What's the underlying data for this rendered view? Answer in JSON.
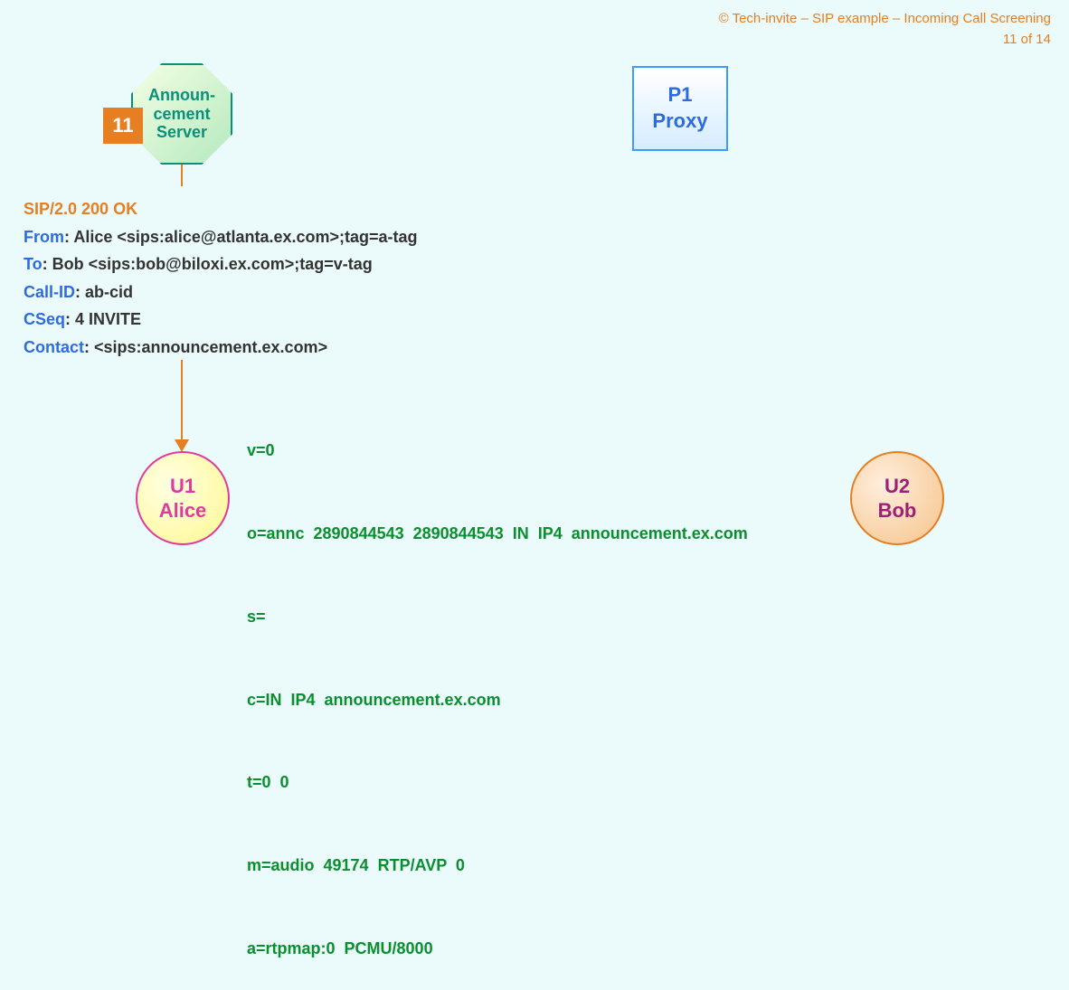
{
  "header": {
    "title": "© Tech-invite – SIP example – Incoming Call Screening",
    "page": "11 of 14"
  },
  "step": "11",
  "announcement": {
    "line1": "Announ-",
    "line2": "cement",
    "line3": "Server"
  },
  "proxy": {
    "line1": "P1",
    "line2": "Proxy"
  },
  "alice": {
    "line1": "U1",
    "line2": "Alice"
  },
  "bob": {
    "line1": "U2",
    "line2": "Bob"
  },
  "sip": {
    "status": "SIP/2.0 200 OK",
    "headers": [
      {
        "name": "From",
        "value": ": Alice <sips:alice@atlanta.ex.com>;tag=a-tag"
      },
      {
        "name": "To",
        "value": ": Bob <sips:bob@biloxi.ex.com>;tag=v-tag"
      },
      {
        "name": "Call-ID",
        "value": ": ab-cid"
      },
      {
        "name": "CSeq",
        "value": ": 4 INVITE"
      },
      {
        "name": "Contact",
        "value": ": <sips:announcement.ex.com>"
      }
    ]
  },
  "sdp": [
    "v=0",
    "o=annc  2890844543  2890844543  IN  IP4  announcement.ex.com",
    "s=",
    "c=IN  IP4  announcement.ex.com",
    "t=0  0",
    "m=audio  49174  RTP/AVP  0",
    "a=rtpmap:0  PCMU/8000"
  ]
}
